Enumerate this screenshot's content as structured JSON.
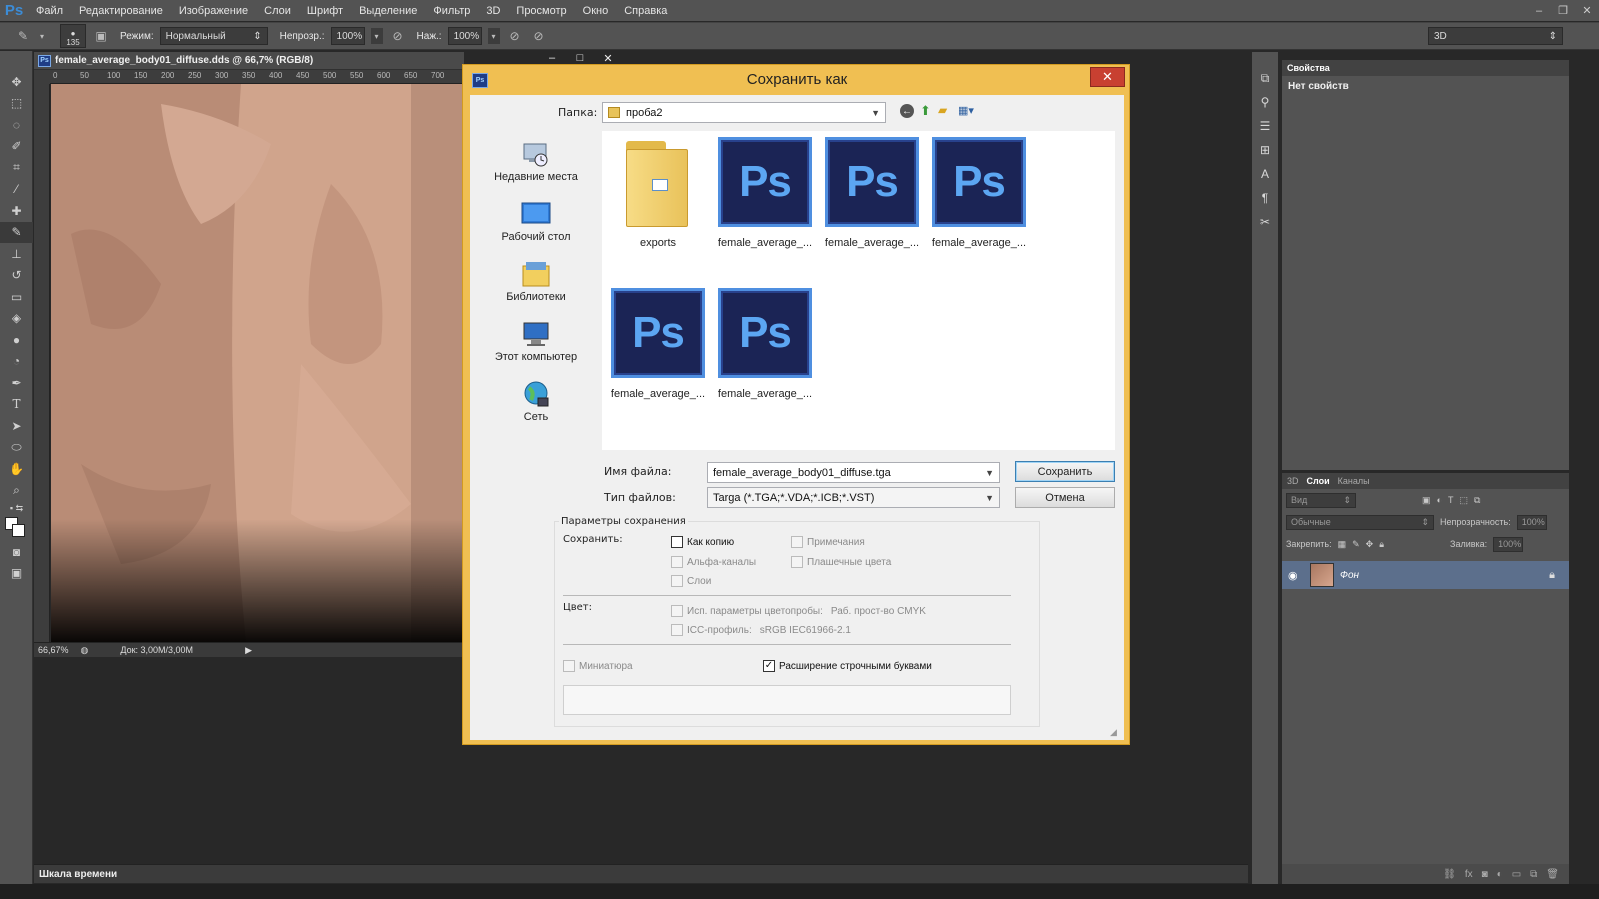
{
  "app": {
    "logo": "Ps",
    "menu": [
      "Файл",
      "Редактирование",
      "Изображение",
      "Слои",
      "Шрифт",
      "Выделение",
      "Фильтр",
      "3D",
      "Просмотр",
      "Окно",
      "Справка"
    ],
    "window_controls": [
      "–",
      "❐",
      "✕"
    ]
  },
  "options_bar": {
    "brush_size": "135",
    "mode_label": "Режим:",
    "mode_value": "Нормальный",
    "opacity_label": "Непрозр.:",
    "opacity_value": "100%",
    "pressure_label": "Наж.:",
    "pressure_value": "100%",
    "workspace": "3D"
  },
  "document": {
    "tab_title": "female_average_body01_diffuse.dds @ 66,7% (RGB/8)",
    "ruler_ticks": [
      "0",
      "50",
      "100",
      "150",
      "200",
      "250",
      "300",
      "350",
      "400",
      "450",
      "500",
      "550",
      "600",
      "650",
      "700"
    ],
    "zoom": "66,67%",
    "doc_size": "Док: 3,00M/3,00M"
  },
  "floating_controls": [
    "‒",
    "□",
    "✕"
  ],
  "properties_panel": {
    "tab": "Свойства",
    "message": "Нет свойств"
  },
  "layers_panel": {
    "tabs": [
      "3D",
      "Слои",
      "Каналы"
    ],
    "filter": "Вид",
    "blend_mode": "Обычные",
    "opacity_label": "Непрозрачность:",
    "opacity_value": "100%",
    "lock_label": "Закрепить:",
    "fill_label": "Заливка:",
    "fill_value": "100%",
    "layer_name": "Фон"
  },
  "timeline": {
    "label": "Шкала времени"
  },
  "dialog": {
    "title": "Сохранить как",
    "folder_label": "Папка:",
    "folder_value": "проба2",
    "places": [
      "Недавние места",
      "Рабочий стол",
      "Библиотеки",
      "Этот компьютер",
      "Сеть"
    ],
    "files": [
      {
        "name": "exports",
        "type": "folder"
      },
      {
        "name": "female_average_...",
        "type": "psd"
      },
      {
        "name": "female_average_...",
        "type": "psd"
      },
      {
        "name": "female_average_...",
        "type": "psd"
      },
      {
        "name": "female_average_...",
        "type": "psd"
      },
      {
        "name": "female_average_...",
        "type": "psd"
      }
    ],
    "filename_label": "Имя файла:",
    "filename_value": "female_average_body01_diffuse.tga",
    "filetype_label": "Тип файлов:",
    "filetype_value": "Targa (*.TGA;*.VDA;*.ICB;*.VST)",
    "save_button": "Сохранить",
    "cancel_button": "Отмена",
    "params_title": "Параметры сохранения",
    "save_group_label": "Сохранить:",
    "options": {
      "as_copy": {
        "label": "Как копию",
        "checked": false,
        "enabled": true
      },
      "notes": {
        "label": "Примечания",
        "checked": false,
        "enabled": false
      },
      "alpha": {
        "label": "Альфа-каналы",
        "checked": false,
        "enabled": false
      },
      "spot": {
        "label": "Плашечные цвета",
        "checked": false,
        "enabled": false
      },
      "layers": {
        "label": "Слои",
        "checked": false,
        "enabled": false
      }
    },
    "color_label": "Цвет:",
    "proof_label": "Исп. параметры цветопробы:",
    "proof_value": "Раб. прост-во CMYK",
    "icc_label": "ICC-профиль:",
    "icc_value": "sRGB IEC61966-2.1",
    "thumbnail_label": "Миниатюра",
    "lowercase_label": "Расширение строчными буквами",
    "lowercase_checked": true
  }
}
